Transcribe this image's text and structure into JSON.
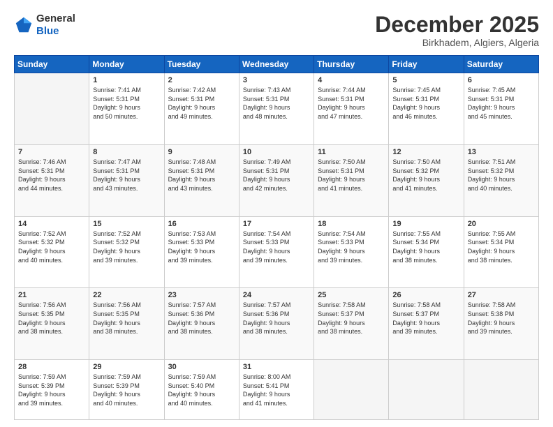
{
  "header": {
    "logo_general": "General",
    "logo_blue": "Blue",
    "month": "December 2025",
    "location": "Birkhadem, Algiers, Algeria"
  },
  "days_of_week": [
    "Sunday",
    "Monday",
    "Tuesday",
    "Wednesday",
    "Thursday",
    "Friday",
    "Saturday"
  ],
  "weeks": [
    [
      {
        "day": "",
        "info": ""
      },
      {
        "day": "1",
        "info": "Sunrise: 7:41 AM\nSunset: 5:31 PM\nDaylight: 9 hours\nand 50 minutes."
      },
      {
        "day": "2",
        "info": "Sunrise: 7:42 AM\nSunset: 5:31 PM\nDaylight: 9 hours\nand 49 minutes."
      },
      {
        "day": "3",
        "info": "Sunrise: 7:43 AM\nSunset: 5:31 PM\nDaylight: 9 hours\nand 48 minutes."
      },
      {
        "day": "4",
        "info": "Sunrise: 7:44 AM\nSunset: 5:31 PM\nDaylight: 9 hours\nand 47 minutes."
      },
      {
        "day": "5",
        "info": "Sunrise: 7:45 AM\nSunset: 5:31 PM\nDaylight: 9 hours\nand 46 minutes."
      },
      {
        "day": "6",
        "info": "Sunrise: 7:45 AM\nSunset: 5:31 PM\nDaylight: 9 hours\nand 45 minutes."
      }
    ],
    [
      {
        "day": "7",
        "info": "Sunrise: 7:46 AM\nSunset: 5:31 PM\nDaylight: 9 hours\nand 44 minutes."
      },
      {
        "day": "8",
        "info": "Sunrise: 7:47 AM\nSunset: 5:31 PM\nDaylight: 9 hours\nand 43 minutes."
      },
      {
        "day": "9",
        "info": "Sunrise: 7:48 AM\nSunset: 5:31 PM\nDaylight: 9 hours\nand 43 minutes."
      },
      {
        "day": "10",
        "info": "Sunrise: 7:49 AM\nSunset: 5:31 PM\nDaylight: 9 hours\nand 42 minutes."
      },
      {
        "day": "11",
        "info": "Sunrise: 7:50 AM\nSunset: 5:31 PM\nDaylight: 9 hours\nand 41 minutes."
      },
      {
        "day": "12",
        "info": "Sunrise: 7:50 AM\nSunset: 5:32 PM\nDaylight: 9 hours\nand 41 minutes."
      },
      {
        "day": "13",
        "info": "Sunrise: 7:51 AM\nSunset: 5:32 PM\nDaylight: 9 hours\nand 40 minutes."
      }
    ],
    [
      {
        "day": "14",
        "info": "Sunrise: 7:52 AM\nSunset: 5:32 PM\nDaylight: 9 hours\nand 40 minutes."
      },
      {
        "day": "15",
        "info": "Sunrise: 7:52 AM\nSunset: 5:32 PM\nDaylight: 9 hours\nand 39 minutes."
      },
      {
        "day": "16",
        "info": "Sunrise: 7:53 AM\nSunset: 5:33 PM\nDaylight: 9 hours\nand 39 minutes."
      },
      {
        "day": "17",
        "info": "Sunrise: 7:54 AM\nSunset: 5:33 PM\nDaylight: 9 hours\nand 39 minutes."
      },
      {
        "day": "18",
        "info": "Sunrise: 7:54 AM\nSunset: 5:33 PM\nDaylight: 9 hours\nand 39 minutes."
      },
      {
        "day": "19",
        "info": "Sunrise: 7:55 AM\nSunset: 5:34 PM\nDaylight: 9 hours\nand 38 minutes."
      },
      {
        "day": "20",
        "info": "Sunrise: 7:55 AM\nSunset: 5:34 PM\nDaylight: 9 hours\nand 38 minutes."
      }
    ],
    [
      {
        "day": "21",
        "info": "Sunrise: 7:56 AM\nSunset: 5:35 PM\nDaylight: 9 hours\nand 38 minutes."
      },
      {
        "day": "22",
        "info": "Sunrise: 7:56 AM\nSunset: 5:35 PM\nDaylight: 9 hours\nand 38 minutes."
      },
      {
        "day": "23",
        "info": "Sunrise: 7:57 AM\nSunset: 5:36 PM\nDaylight: 9 hours\nand 38 minutes."
      },
      {
        "day": "24",
        "info": "Sunrise: 7:57 AM\nSunset: 5:36 PM\nDaylight: 9 hours\nand 38 minutes."
      },
      {
        "day": "25",
        "info": "Sunrise: 7:58 AM\nSunset: 5:37 PM\nDaylight: 9 hours\nand 38 minutes."
      },
      {
        "day": "26",
        "info": "Sunrise: 7:58 AM\nSunset: 5:37 PM\nDaylight: 9 hours\nand 39 minutes."
      },
      {
        "day": "27",
        "info": "Sunrise: 7:58 AM\nSunset: 5:38 PM\nDaylight: 9 hours\nand 39 minutes."
      }
    ],
    [
      {
        "day": "28",
        "info": "Sunrise: 7:59 AM\nSunset: 5:39 PM\nDaylight: 9 hours\nand 39 minutes."
      },
      {
        "day": "29",
        "info": "Sunrise: 7:59 AM\nSunset: 5:39 PM\nDaylight: 9 hours\nand 40 minutes."
      },
      {
        "day": "30",
        "info": "Sunrise: 7:59 AM\nSunset: 5:40 PM\nDaylight: 9 hours\nand 40 minutes."
      },
      {
        "day": "31",
        "info": "Sunrise: 8:00 AM\nSunset: 5:41 PM\nDaylight: 9 hours\nand 41 minutes."
      },
      {
        "day": "",
        "info": ""
      },
      {
        "day": "",
        "info": ""
      },
      {
        "day": "",
        "info": ""
      }
    ]
  ]
}
